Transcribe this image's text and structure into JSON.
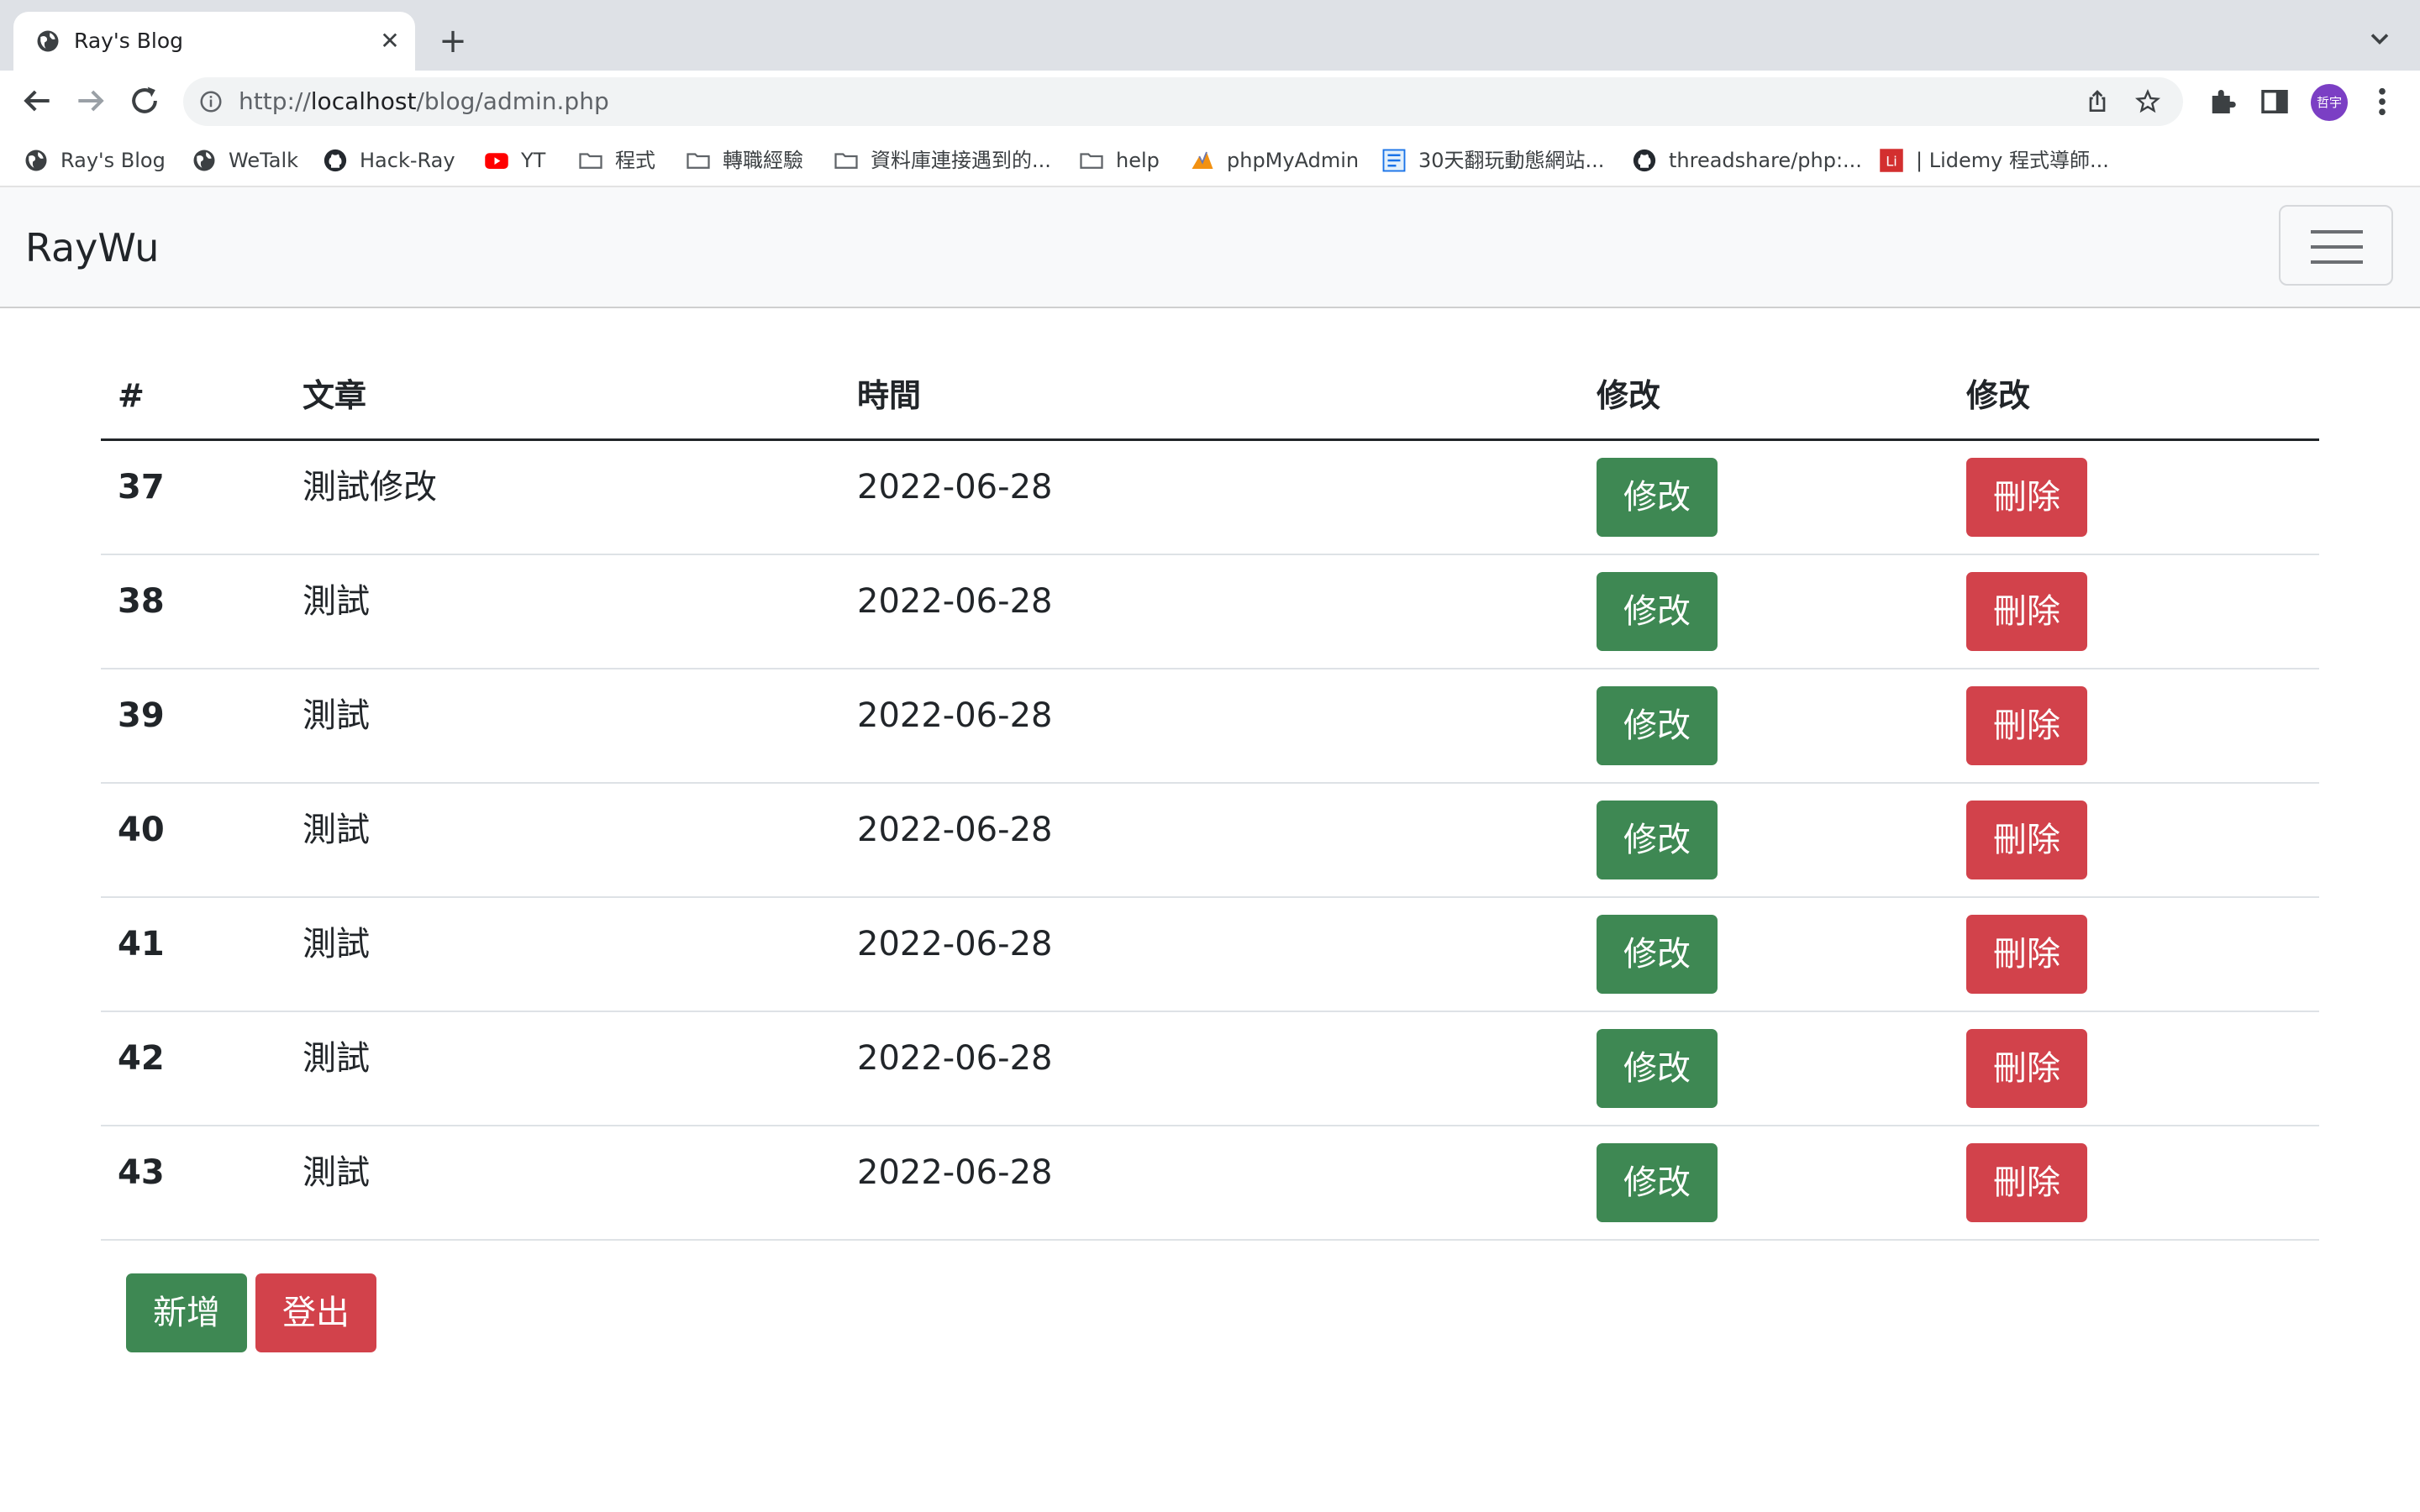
{
  "browser": {
    "tab_title": "Ray's Blog",
    "tab_close": "✕",
    "new_tab": "+",
    "url_scheme": "http://",
    "url_host": "localhost",
    "url_path": "/blog/admin.php",
    "profile_initials": "哲宇"
  },
  "bookmarks": [
    {
      "label": "Ray's Blog",
      "icon": "globe-icon"
    },
    {
      "label": "WeTalk",
      "icon": "globe-icon"
    },
    {
      "label": "Hack-Ray",
      "icon": "github-icon"
    },
    {
      "label": "YT",
      "icon": "youtube-icon"
    },
    {
      "label": "程式",
      "icon": "folder-icon"
    },
    {
      "label": "轉職經驗",
      "icon": "folder-icon"
    },
    {
      "label": "資料庫連接遇到的...",
      "icon": "folder-icon"
    },
    {
      "label": "help",
      "icon": "folder-icon"
    },
    {
      "label": "phpMyAdmin",
      "icon": "phpmyadmin-icon"
    },
    {
      "label": "30天翻玩動態網站...",
      "icon": "site-icon"
    },
    {
      "label": "threadshare/php:...",
      "icon": "github-icon"
    },
    {
      "label": "| Lidemy 程式導師...",
      "icon": "lidemy-icon",
      "icon_text": "Li"
    }
  ],
  "navbar": {
    "brand": "RayWu"
  },
  "table": {
    "headers": [
      "#",
      "文章",
      "時間",
      "修改",
      "修改"
    ],
    "rows": [
      {
        "id": "37",
        "title": "測試修改",
        "date": "2022-06-28",
        "edit": "修改",
        "delete": "刪除"
      },
      {
        "id": "38",
        "title": "測試",
        "date": "2022-06-28",
        "edit": "修改",
        "delete": "刪除"
      },
      {
        "id": "39",
        "title": "測試",
        "date": "2022-06-28",
        "edit": "修改",
        "delete": "刪除"
      },
      {
        "id": "40",
        "title": "測試",
        "date": "2022-06-28",
        "edit": "修改",
        "delete": "刪除"
      },
      {
        "id": "41",
        "title": "測試",
        "date": "2022-06-28",
        "edit": "修改",
        "delete": "刪除"
      },
      {
        "id": "42",
        "title": "測試",
        "date": "2022-06-28",
        "edit": "修改",
        "delete": "刪除"
      },
      {
        "id": "43",
        "title": "測試",
        "date": "2022-06-28",
        "edit": "修改",
        "delete": "刪除"
      }
    ]
  },
  "actions": {
    "add": "新增",
    "logout": "登出"
  },
  "colors": {
    "success": "#3e8853",
    "danger": "#d2424b",
    "navbar_bg": "#f8f9fa"
  }
}
